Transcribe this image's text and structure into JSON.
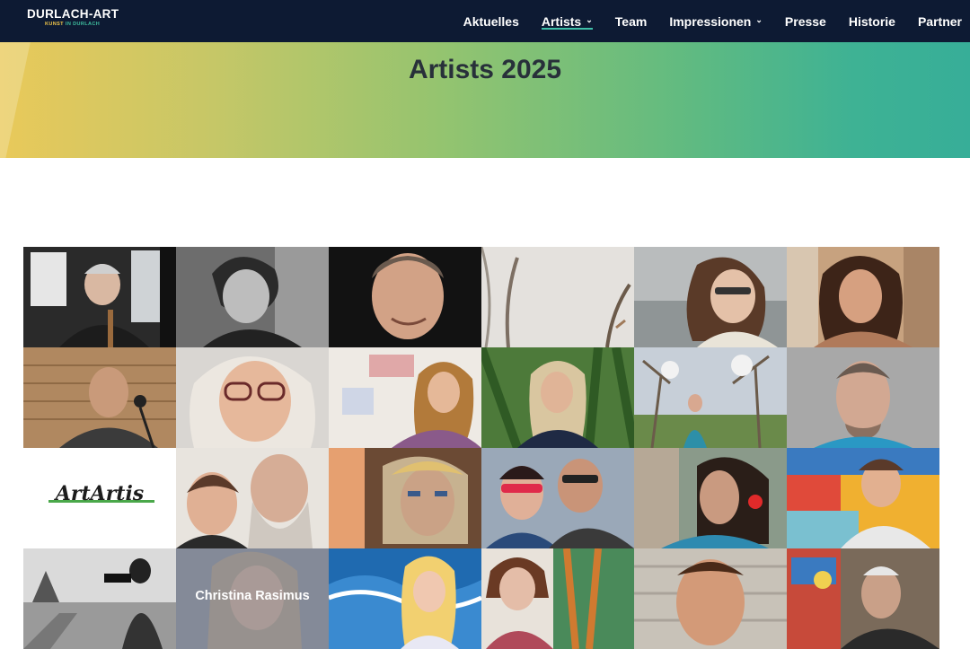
{
  "header": {
    "logo": {
      "main": "DURLACH-ART",
      "sub_part1": "KUNST",
      "sub_part2": "IN DURLACH"
    },
    "nav": [
      {
        "label": "Aktuelles",
        "dropdown": false,
        "active": false
      },
      {
        "label": "Artists",
        "dropdown": true,
        "active": true
      },
      {
        "label": "Team",
        "dropdown": false,
        "active": false
      },
      {
        "label": "Impressionen",
        "dropdown": true,
        "active": false
      },
      {
        "label": "Presse",
        "dropdown": false,
        "active": false
      },
      {
        "label": "Historie",
        "dropdown": false,
        "active": false
      },
      {
        "label": "Partner",
        "dropdown": false,
        "active": false
      }
    ],
    "colors": {
      "bar": "#0d1a33",
      "active_underline": "#3fbfa8"
    }
  },
  "banner": {
    "title": "Artists 2025"
  },
  "artists_grid": {
    "rows": 4,
    "columns": 6,
    "hover_label": "Christina Rasimus",
    "logo_tile_text": "ArtArtis"
  }
}
